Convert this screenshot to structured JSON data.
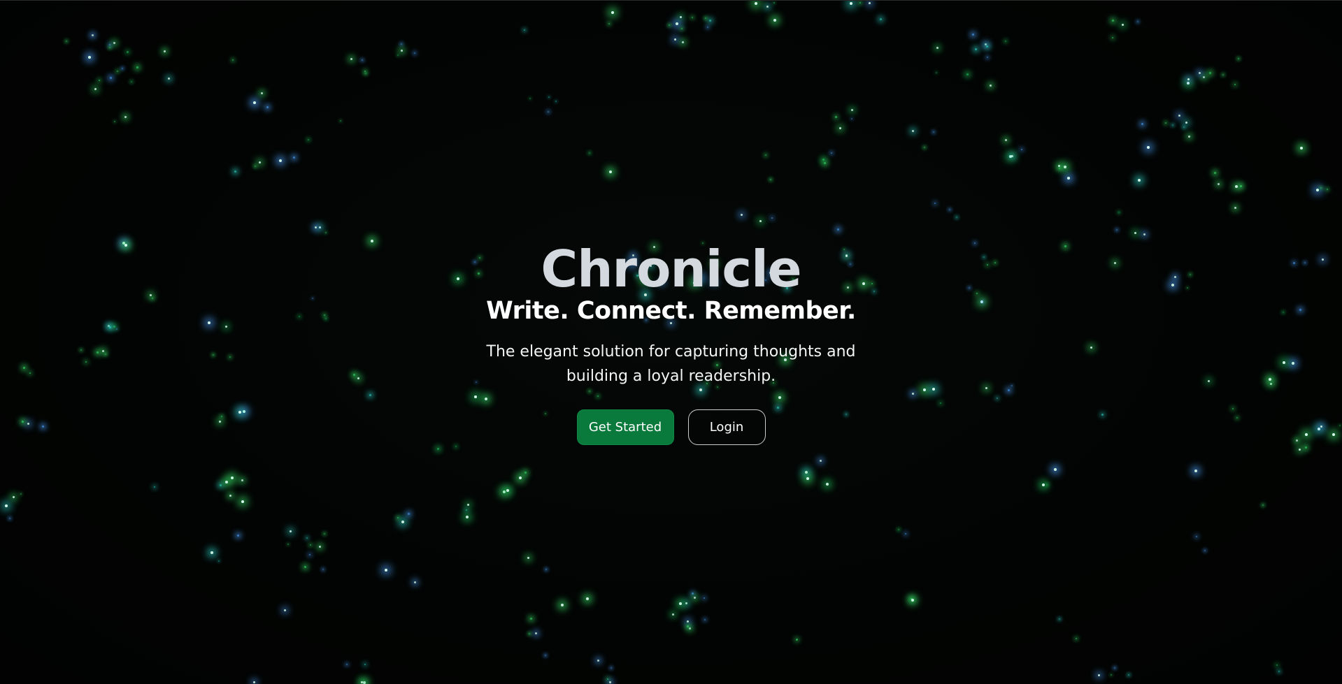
{
  "hero": {
    "title": "Chronicle",
    "tagline": "Write. Connect. Remember.",
    "description": "The elegant solution for capturing thoughts and building a loyal readership."
  },
  "actions": {
    "primary_label": "Get Started",
    "secondary_label": "Login"
  },
  "colors": {
    "background": "#020403",
    "title": "#d3d9df",
    "primary_button": "#0a7a3c",
    "star_green": "#39e66b",
    "star_blue": "#4da3ff"
  }
}
